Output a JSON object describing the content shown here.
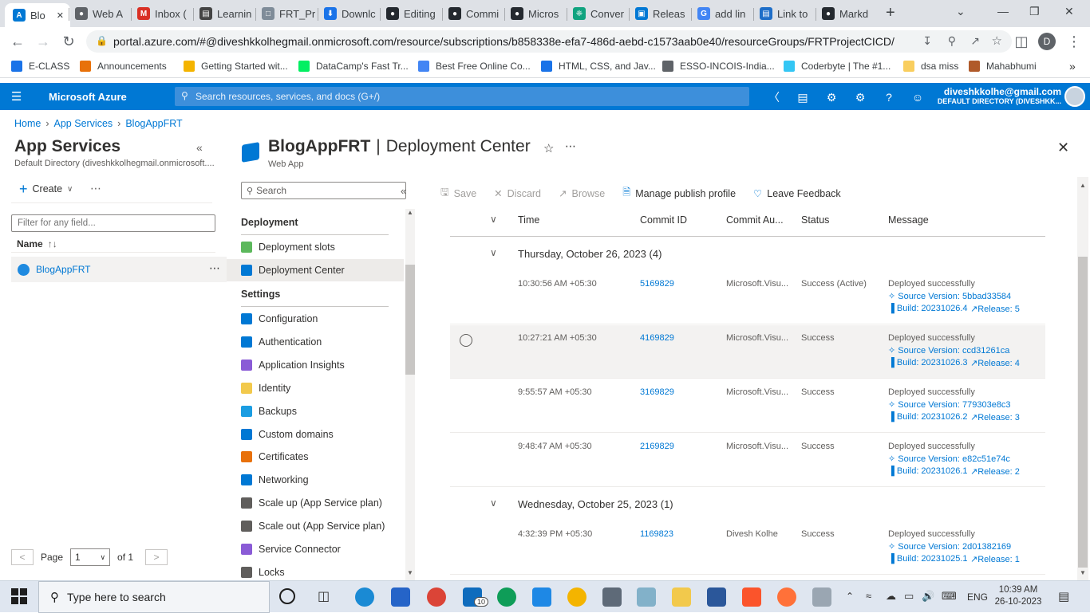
{
  "browser": {
    "tabs": [
      {
        "label": "Blo",
        "color": "#0078d4",
        "glyph": "A"
      },
      {
        "label": "Web A",
        "color": "#5f6368",
        "glyph": "●"
      },
      {
        "label": "Inbox (",
        "color": "#d93025",
        "glyph": "M"
      },
      {
        "label": "Learnin",
        "color": "#444",
        "glyph": "▤"
      },
      {
        "label": "FRT_Pr",
        "color": "#7f8c99",
        "glyph": "□"
      },
      {
        "label": "Downlc",
        "color": "#1a73e8",
        "glyph": "⬇"
      },
      {
        "label": "Editing",
        "color": "#24292f",
        "glyph": "●"
      },
      {
        "label": "Commi",
        "color": "#24292f",
        "glyph": "●"
      },
      {
        "label": "Micros",
        "color": "#24292f",
        "glyph": "●"
      },
      {
        "label": "Conver",
        "color": "#10a37f",
        "glyph": "❈"
      },
      {
        "label": "Releas",
        "color": "#0078d4",
        "glyph": "▣"
      },
      {
        "label": "add lin",
        "color": "#4285f4",
        "glyph": "G"
      },
      {
        "label": "Link to",
        "color": "#1e6ec8",
        "glyph": "▤"
      },
      {
        "label": "Markd",
        "color": "#24292f",
        "glyph": "●"
      }
    ],
    "new_tab": "+",
    "url": "portal.azure.com/#@diveshkkolhegmail.onmicrosoft.com/resource/subscriptions/b858338e-efa7-486d-aebd-c1573aab0e40/resourceGroups/FRTProjectCICD/...",
    "profile_initial": "D",
    "bookmarks": [
      {
        "label": "E-CLASS",
        "color": "#1a73e8"
      },
      {
        "label": "Announcements",
        "color": "#e8710a"
      },
      {
        "label": "Getting Started wit...",
        "color": "#f4b400"
      },
      {
        "label": "DataCamp's Fast Tr...",
        "color": "#03ef62"
      },
      {
        "label": "Best Free Online Co...",
        "color": "#4285f4"
      },
      {
        "label": "HTML, CSS, and Jav...",
        "color": "#1a73e8"
      },
      {
        "label": "ESSO-INCOIS-India...",
        "color": "#5f6368"
      },
      {
        "label": "Coderbyte | The #1...",
        "color": "#34c6f4"
      },
      {
        "label": "dsa miss",
        "color": "#f9ce5e"
      },
      {
        "label": "Mahabhumi",
        "color": "#b05a2a"
      }
    ]
  },
  "azure": {
    "brand": "Microsoft Azure",
    "search_placeholder": "Search resources, services, and docs (G+/)",
    "user_email": "diveshkkolhe@gmail.com",
    "user_directory": "DEFAULT DIRECTORY (DIVESHKK..."
  },
  "breadcrumb": [
    "Home",
    "App Services",
    "BlogAppFRT"
  ],
  "left_panel": {
    "title": "App Services",
    "subtitle": "Default Directory (diveshkkolhegmail.onmicrosoft....",
    "create_label": "Create",
    "filter_placeholder": "Filter for any field...",
    "column_name": "Name",
    "item": "BlogAppFRT",
    "page_label": "Page",
    "page_value": "1",
    "page_of": "of 1"
  },
  "resource": {
    "name": "BlogAppFRT",
    "separator": "|",
    "blade": "Deployment Center",
    "type": "Web App"
  },
  "menu": {
    "search_placeholder": "Search",
    "sections": [
      {
        "heading": "Deployment",
        "items": [
          {
            "label": "Deployment slots",
            "icon": "deployment-slots-icon",
            "color": "#5cb85c"
          },
          {
            "label": "Deployment Center",
            "icon": "deployment-center-icon",
            "color": "#0078d4"
          }
        ]
      },
      {
        "heading": "Settings",
        "items": [
          {
            "label": "Configuration",
            "icon": "configuration-icon",
            "color": "#0078d4"
          },
          {
            "label": "Authentication",
            "icon": "authentication-icon",
            "color": "#0078d4"
          },
          {
            "label": "Application Insights",
            "icon": "application-insights-icon",
            "color": "#8a5bd6"
          },
          {
            "label": "Identity",
            "icon": "identity-icon",
            "color": "#f2c94c"
          },
          {
            "label": "Backups",
            "icon": "backups-icon",
            "color": "#1b9de2"
          },
          {
            "label": "Custom domains",
            "icon": "custom-domains-icon",
            "color": "#0078d4"
          },
          {
            "label": "Certificates",
            "icon": "certificates-icon",
            "color": "#e8710a"
          },
          {
            "label": "Networking",
            "icon": "networking-icon",
            "color": "#0078d4"
          },
          {
            "label": "Scale up (App Service plan)",
            "icon": "scale-up-icon",
            "color": "#605e5c"
          },
          {
            "label": "Scale out (App Service plan)",
            "icon": "scale-out-icon",
            "color": "#605e5c"
          },
          {
            "label": "Service Connector",
            "icon": "service-connector-icon",
            "color": "#8a5bd6"
          },
          {
            "label": "Locks",
            "icon": "locks-icon",
            "color": "#605e5c"
          }
        ]
      }
    ]
  },
  "toolbar": {
    "save": "Save",
    "discard": "Discard",
    "browse": "Browse",
    "manage": "Manage publish profile",
    "feedback": "Leave Feedback"
  },
  "logs": {
    "columns": [
      "Time",
      "Commit ID",
      "Commit Au...",
      "Status",
      "Message"
    ],
    "groups": [
      {
        "header": "Thursday, October 26, 2023 (4)",
        "rows": [
          {
            "time": "10:30:56 AM +05:30",
            "commit": "5169829",
            "author": "Microsoft.Visu...",
            "status": "Success (Active)",
            "message": "Deployed successfully",
            "source": "Source Version: 5bbad33584",
            "build": "Build: 20231026.4",
            "release": "Release: 5",
            "selected": false
          },
          {
            "time": "10:27:21 AM +05:30",
            "commit": "4169829",
            "author": "Microsoft.Visu...",
            "status": "Success",
            "message": "Deployed successfully",
            "source": "Source Version: ccd31261ca",
            "build": "Build: 20231026.3",
            "release": "Release: 4",
            "selected": true
          },
          {
            "time": "9:55:57 AM +05:30",
            "commit": "3169829",
            "author": "Microsoft.Visu...",
            "status": "Success",
            "message": "Deployed successfully",
            "source": "Source Version: 779303e8c3",
            "build": "Build: 20231026.2",
            "release": "Release: 3",
            "selected": false
          },
          {
            "time": "9:48:47 AM +05:30",
            "commit": "2169829",
            "author": "Microsoft.Visu...",
            "status": "Success",
            "message": "Deployed successfully",
            "source": "Source Version: e82c51e74c",
            "build": "Build: 20231026.1",
            "release": "Release: 2",
            "selected": false
          }
        ]
      },
      {
        "header": "Wednesday, October 25, 2023 (1)",
        "rows": [
          {
            "time": "4:32:39 PM +05:30",
            "commit": "1169823",
            "author": "Divesh Kolhe",
            "status": "Success",
            "message": "Deployed successfully",
            "source": "Source Version: 2d01382169",
            "build": "Build: 20231025.1",
            "release": "Release: 1",
            "selected": false
          }
        ]
      }
    ]
  },
  "taskbar": {
    "search_placeholder": "Type here to search",
    "language": "ENG",
    "time": "10:39 AM",
    "date": "26-10-2023",
    "badge": "10"
  }
}
